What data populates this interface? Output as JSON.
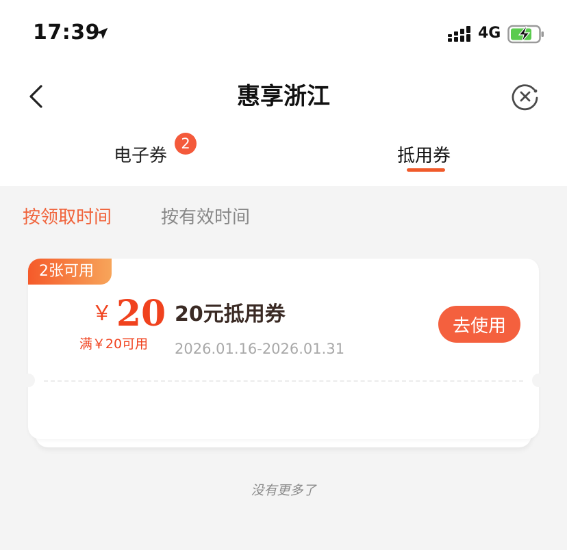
{
  "status_bar": {
    "time": "17:39",
    "network": "4G"
  },
  "nav": {
    "title": "惠享浙江"
  },
  "tabs": [
    {
      "label": "电子券",
      "badge": "2",
      "active": false
    },
    {
      "label": "抵用券",
      "active": true
    }
  ],
  "sort_options": [
    {
      "label": "按领取时间",
      "active": true
    },
    {
      "label": "按有效时间",
      "active": false
    }
  ],
  "coupon": {
    "available_label": "2张可用",
    "currency": "￥",
    "amount": "20",
    "condition": "满￥20可用",
    "title": "20元抵用券",
    "period": "2026.01.16-2026.01.31",
    "action_label": "去使用"
  },
  "footer": {
    "no_more": "没有更多了"
  },
  "colors": {
    "accent": "#f0421e",
    "button": "#f4603e",
    "tab_underline": "#f05a2a",
    "badge": "#f45a3b"
  }
}
